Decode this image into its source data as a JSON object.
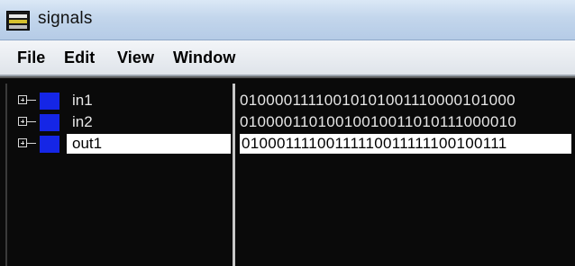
{
  "window": {
    "title": "signals"
  },
  "menu": {
    "items": [
      "File",
      "Edit",
      "View",
      "Window"
    ]
  },
  "signals": [
    {
      "name": "in1",
      "value": "01000011110010101001110000101000",
      "color": "#1526e6",
      "selected": false
    },
    {
      "name": "in2",
      "value": "01000011010010010011010111000010",
      "color": "#1526e6",
      "selected": false
    },
    {
      "name": "out1",
      "value": "01000111100111110011111100100111",
      "color": "#1526e6",
      "selected": true
    }
  ],
  "colors": {
    "panel_bg": "#0a0a0a",
    "selection_bg": "#ffffff",
    "text": "#e6e6e6"
  }
}
